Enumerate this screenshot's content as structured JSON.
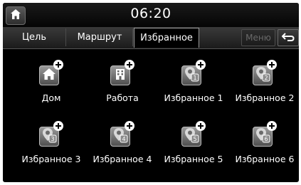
{
  "status_bar": {
    "time": "06:20"
  },
  "tabs": [
    {
      "label": "Цель"
    },
    {
      "label": "Маршрут"
    },
    {
      "label": "Избранное",
      "active": true
    }
  ],
  "menu_label": "Меню",
  "favorites": [
    {
      "label": "Дом",
      "icon": "home-icon"
    },
    {
      "label": "Работа",
      "icon": "office-building-icon"
    },
    {
      "label": "Избранное 1",
      "icon": "favorite-pin-icon",
      "number": "1"
    },
    {
      "label": "Избранное 2",
      "icon": "favorite-pin-icon",
      "number": "2"
    },
    {
      "label": "Избранное 3",
      "icon": "favorite-pin-icon",
      "number": "3"
    },
    {
      "label": "Избранное 4",
      "icon": "favorite-pin-icon",
      "number": "4"
    },
    {
      "label": "Избранное 5",
      "icon": "favorite-pin-icon",
      "number": "5"
    },
    {
      "label": "Избранное 6",
      "icon": "favorite-pin-icon",
      "number": "6"
    }
  ],
  "colors": {
    "background": "#000000",
    "text": "#ffffff",
    "disabled": "#6a6a6a"
  }
}
